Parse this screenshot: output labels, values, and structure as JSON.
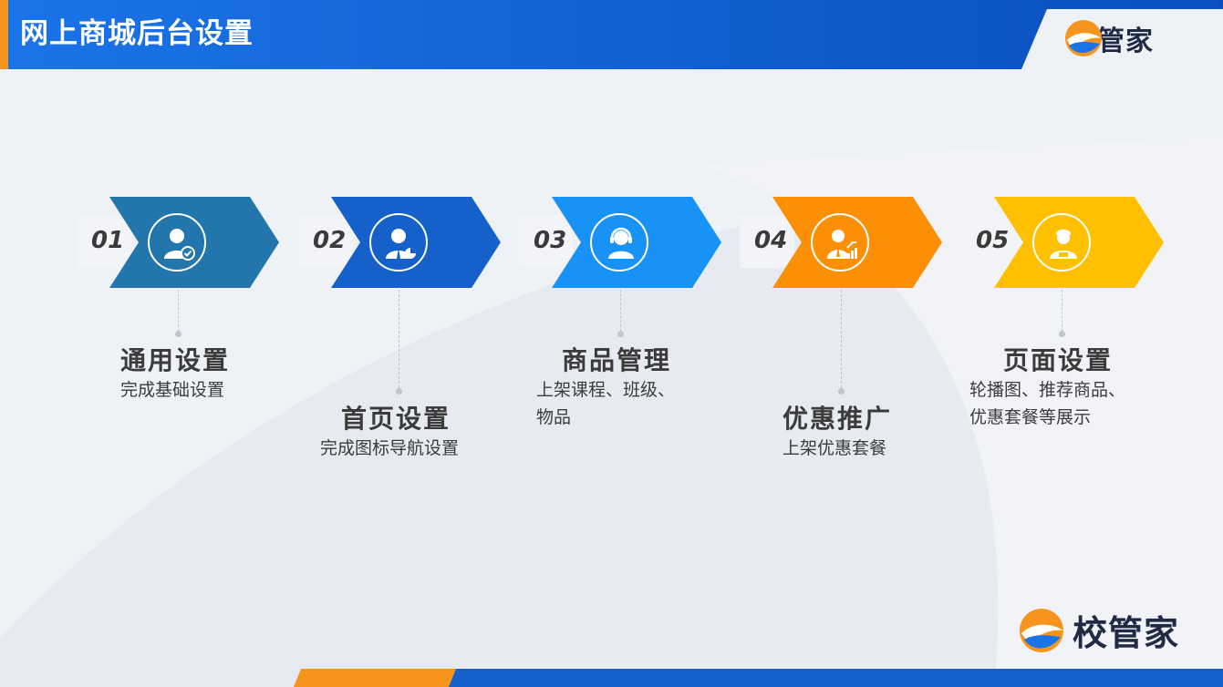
{
  "header": {
    "title": "网上商城后台设置"
  },
  "brand": {
    "name": "校管家"
  },
  "colors": {
    "header_blue": "#0f55c9",
    "accent_orange": "#f7941d",
    "step1": "#2376ac",
    "step2": "#1561c9",
    "step3": "#1893f5",
    "step4": "#fb8f05",
    "step5": "#fec000"
  },
  "steps": [
    {
      "number": "01",
      "icon": "user-check-icon",
      "title": "通用设置",
      "desc_lines": [
        "完成基础设置"
      ]
    },
    {
      "number": "02",
      "icon": "user-chart-icon",
      "title": "首页设置",
      "desc_lines": [
        "完成图标导航设置"
      ]
    },
    {
      "number": "03",
      "icon": "headset-user-icon",
      "title": "商品管理",
      "desc_lines": [
        "上架课程、班级、",
        "物品"
      ]
    },
    {
      "number": "04",
      "icon": "user-growth-icon",
      "title": "优惠推广",
      "desc_lines": [
        "上架优惠套餐"
      ]
    },
    {
      "number": "05",
      "icon": "user-badge-icon",
      "title": "页面设置",
      "desc_lines": [
        "轮播图、推荐商品、",
        "优惠套餐等展示"
      ]
    }
  ]
}
